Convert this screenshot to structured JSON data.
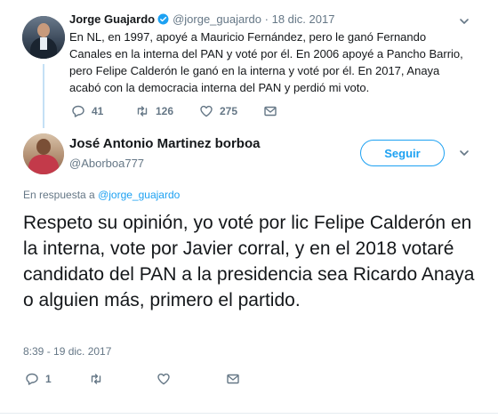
{
  "parent_tweet": {
    "author_name": "Jorge Guajardo",
    "author_handle": "@jorge_guajardo",
    "separator": "·",
    "date": "18 dic. 2017",
    "text": "En NL, en 1997, apoyé a Mauricio Fernández, pero le ganó Fernando Canales en la interna del PAN y voté por él. En 2006 apoyé a Pancho Barrio, pero Felipe Calderón le ganó en la interna y voté por él. En 2017, Anaya acabó con la democracia interna del PAN y perdió mi voto.",
    "replies": "41",
    "retweets": "126",
    "likes": "275"
  },
  "reply_tweet": {
    "author_name": "José Antonio Martinez borboa",
    "author_handle": "@Aborboa777",
    "follow_label": "Seguir",
    "reply_prefix": "En respuesta a",
    "reply_to": "@jorge_guajardo",
    "text": "Respeto su opinión, yo voté por lic Felipe Calderón en la interna, vote por Javier corral, y en el 2018 votaré candidato del PAN a la presidencia sea Ricardo Anaya o alguien más, primero el partido.",
    "timestamp": "8:39 - 19 dic. 2017",
    "replies": "1"
  },
  "colors": {
    "accent": "#1da1f2",
    "text": "#14171a",
    "muted": "#657786",
    "thread_line": "#c4e0f5"
  },
  "icons": {
    "verified": "verified-badge-icon",
    "caret": "chevron-down-icon",
    "reply": "reply-icon",
    "retweet": "retweet-icon",
    "like": "heart-icon",
    "dm": "envelope-icon"
  }
}
